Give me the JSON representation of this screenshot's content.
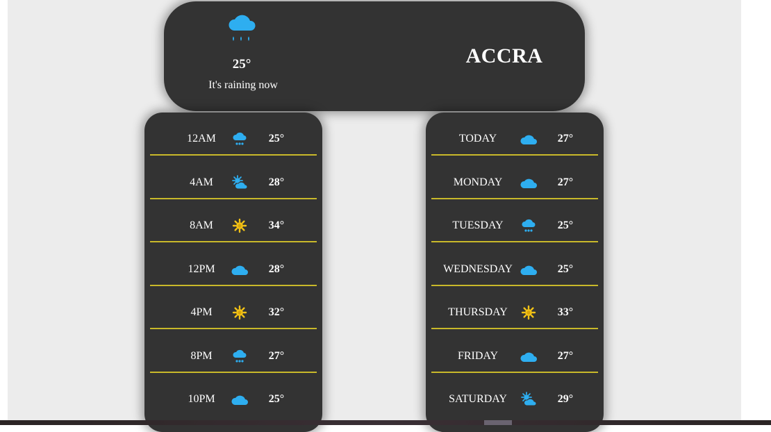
{
  "current": {
    "temp": "25°",
    "status": "It's raining now",
    "city": "ACCRA",
    "icon": "rain-icon"
  },
  "colors": {
    "card": "#333333",
    "background": "#ececec",
    "divider": "#c9b92a",
    "cloud": "#2eaef0",
    "sun": "#f3c316"
  },
  "hourly": [
    {
      "time": "12AM",
      "icon": "rain",
      "temp": "25°"
    },
    {
      "time": "4AM",
      "icon": "partly",
      "temp": "28°"
    },
    {
      "time": "8AM",
      "icon": "sun",
      "temp": "34°"
    },
    {
      "time": "12PM",
      "icon": "cloud",
      "temp": "28°"
    },
    {
      "time": "4PM",
      "icon": "sun",
      "temp": "32°"
    },
    {
      "time": "8PM",
      "icon": "rain",
      "temp": "27°"
    },
    {
      "time": "10PM",
      "icon": "cloud",
      "temp": "25°"
    }
  ],
  "daily": [
    {
      "day": "TODAY",
      "icon": "cloud",
      "temp": "27°"
    },
    {
      "day": "MONDAY",
      "icon": "cloud",
      "temp": "27°"
    },
    {
      "day": "TUESDAY",
      "icon": "rain",
      "temp": "25°"
    },
    {
      "day": "WEDNESDAY",
      "icon": "cloud",
      "temp": "25°"
    },
    {
      "day": "THURSDAY",
      "icon": "sun",
      "temp": "33°"
    },
    {
      "day": "FRIDAY",
      "icon": "cloud",
      "temp": "27°"
    },
    {
      "day": "SATURDAY",
      "icon": "partly",
      "temp": "29°"
    }
  ]
}
